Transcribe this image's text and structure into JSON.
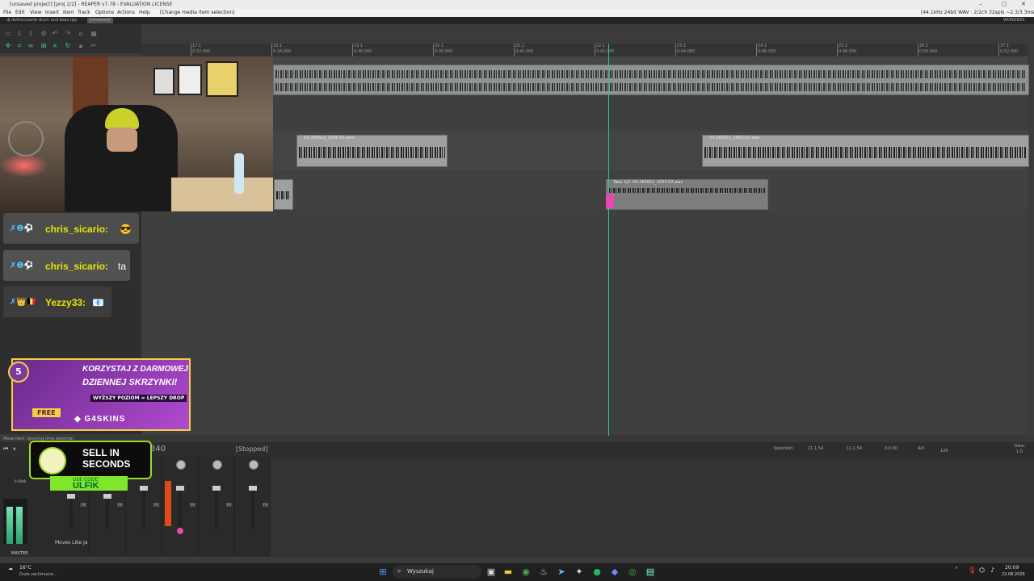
{
  "window": {
    "title": "[unsaved project] [proj 2/2] - REAPER v7.78 - EVALUATION LICENSE",
    "audio_info": "[44.1kHz 24bit WAV : 2/2ch 32spls ~2.3/3.3ms ASIO]"
  },
  "menu": {
    "items": [
      "File",
      "Edit",
      "View",
      "Insert",
      "Item",
      "Track",
      "Options",
      "Actions",
      "Help"
    ],
    "hint": "[Change media item selection]"
  },
  "tabs": {
    "project": "dj doktorczanie drum and bass.rpp",
    "current": "[Unsaved]",
    "right": "WONDERS"
  },
  "ruler": {
    "markers": [
      {
        "bar": "17.1",
        "time": "0:32.000"
      },
      {
        "bar": "18.1",
        "time": "0:34.000"
      },
      {
        "bar": "19.1",
        "time": "0:36.000"
      },
      {
        "bar": "20.1",
        "time": "0:38.000"
      },
      {
        "bar": "21.1",
        "time": "0:40.000"
      },
      {
        "bar": "22.1",
        "time": "0:42.000"
      },
      {
        "bar": "23.1",
        "time": "0:44.000"
      },
      {
        "bar": "24.1",
        "time": "0:46.000"
      },
      {
        "bar": "25.1",
        "time": "0:48.000"
      },
      {
        "bar": "26.1",
        "time": "0:50.000"
      },
      {
        "bar": "27.1",
        "time": "0:52.000"
      }
    ]
  },
  "items": {
    "item1": "03-260822_2006-01.wav",
    "item2": "03-260822_1953-01.wav",
    "item3": "Take 1/2: 04-260822_2007-02.wav"
  },
  "chat": [
    {
      "user": "chris_sicario:",
      "msg": "😎",
      "badges": "✗❶⚽"
    },
    {
      "user": "chris_sicario:",
      "msg": "ta",
      "badges": "✗❶⚽"
    },
    {
      "user": "Yezzy33:",
      "msg": "📧",
      "badges": "✗👑🇧🇪"
    }
  ],
  "promo": {
    "level": "5",
    "line1": "KORZYSTAJ Z DARMOWEJ",
    "line2": "DZIENNEJ SKRZYNKI!",
    "line3": "WYŻSZY POZIOM = LEPSZY DROP",
    "free": "FREE",
    "brand": "G4SKINS"
  },
  "sponsor": {
    "line1": "SELL IN",
    "line2": "SECONDS",
    "use_code": "USE CODE:",
    "code": "ULFIK"
  },
  "transport": {
    "hint": "Move item: ignoring time selection",
    "position": "340",
    "state": "[Stopped]"
  },
  "selection": {
    "label": "Selection:",
    "start": "11.1.54",
    "end": "11.1.54",
    "length": "0.0.00",
    "timesig": "4/4",
    "bpm": "120",
    "rate_label": "Rate:",
    "rate": "1.0"
  },
  "mixer": {
    "master": "MASTER",
    "track_name": "Moves Like Ja",
    "master_db": "0.00dB"
  },
  "taskbar": {
    "weather_temp": "16°C",
    "weather_desc": "Duże zachmurze...",
    "search": "Wyszukaj",
    "time": "20:09",
    "date": "22.08.2026"
  }
}
